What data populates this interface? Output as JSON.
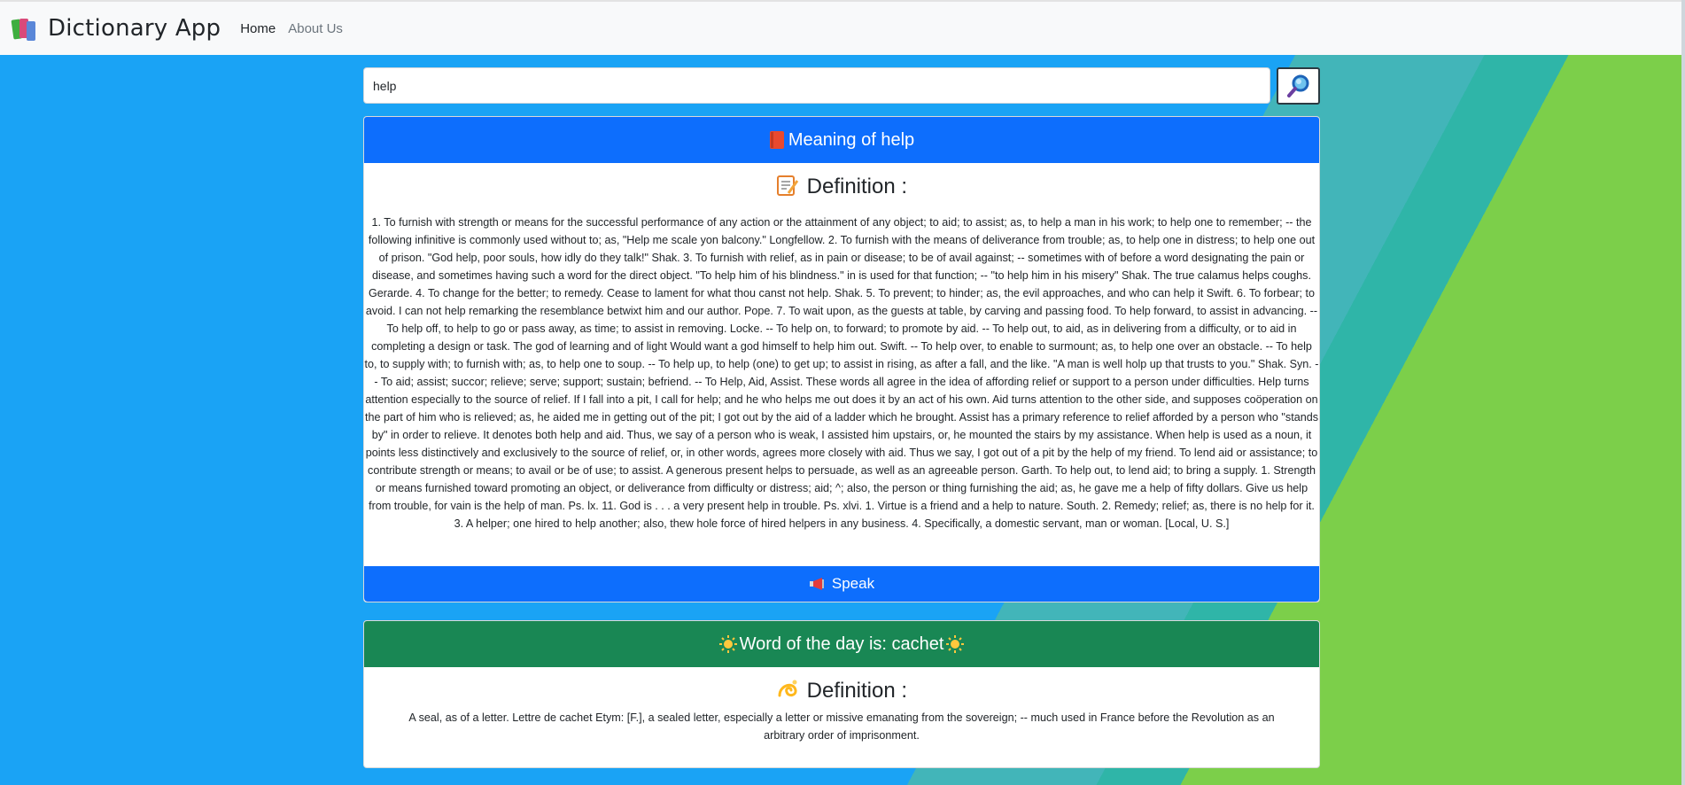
{
  "nav": {
    "brand": "Dictionary App",
    "links": [
      "Home",
      "About Us"
    ]
  },
  "search": {
    "value": "help",
    "button_icon": "magnifier-icon"
  },
  "meaning_card": {
    "header": "Meaning of help",
    "definition_title": "Definition :",
    "definition_text": "1. To furnish with strength or means for the successful performance of any action or the attainment of any object; to aid; to assist; as, to help a man in his work; to help one to remember; -- the following infinitive is commonly used without to; as, \"Help me scale yon balcony.\" Longfellow. 2. To furnish with the means of deliverance from trouble; as, to help one in distress; to help one out of prison. \"God help, poor souls, how idly do they talk!\" Shak. 3. To furnish with relief, as in pain or disease; to be of avail against; -- sometimes with of before a word designating the pain or disease, and sometimes having such a word for the direct object. \"To help him of his blindness.\" in is used for that function; -- \"to help him in his misery\" Shak. The true calamus helps coughs. Gerarde. 4. To change for the better; to remedy. Cease to lament for what thou canst not help. Shak. 5. To prevent; to hinder; as, the evil approaches, and who can help it Swift. 6. To forbear; to avoid. I can not help remarking the resemblance betwixt him and our author. Pope. 7. To wait upon, as the guests at table, by carving and passing food. To help forward, to assist in advancing. -- To help off, to help to go or pass away, as time; to assist in removing. Locke. -- To help on, to forward; to promote by aid. -- To help out, to aid, as in delivering from a difficulty, or to aid in completing a design or task. The god of learning and of light Would want a god himself to help him out. Swift. -- To help over, to enable to surmount; as, to help one over an obstacle. -- To help to, to supply with; to furnish with; as, to help one to soup. -- To help up, to help (one) to get up; to assist in rising, as after a fall, and the like. \"A man is well holp up that trusts to you.\" Shak. Syn. -- To aid; assist; succor; relieve; serve; support; sustain; befriend. -- To Help, Aid, Assist. These words all agree in the idea of affording relief or support to a person under difficulties. Help turns attention especially to the source of relief. If I fall into a pit, I call for help; and he who helps me out does it by an act of his own. Aid turns attention to the other side, and supposes coöperation on the part of him who is relieved; as, he aided me in getting out of the pit; I got out by the aid of a ladder which he brought. Assist has a primary reference to relief afforded by a person who \"stands by\" in order to relieve. It denotes both help and aid. Thus, we say of a person who is weak, I assisted him upstairs, or, he mounted the stairs by my assistance. When help is used as a noun, it points less distinctively and exclusively to the source of relief, or, in other words, agrees more closely with aid. Thus we say, I got out of a pit by the help of my friend. To lend aid or assistance; to contribute strength or means; to avail or be of use; to assist. A generous present helps to persuade, as well as an agreeable person. Garth. To help out, to lend aid; to bring a supply. 1. Strength or means furnished toward promoting an object, or deliverance from difficulty or distress; aid; ^; also, the person or thing furnishing the aid; as, he gave me a help of fifty dollars. Give us help from trouble, for vain is the help of man. Ps. lx. 11. God is . . . a very present help in trouble. Ps. xlvi. 1. Virtue is a friend and a help to nature. South. 2. Remedy; relief; as, there is no help for it. 3. A helper; one hired to help another; also, thew hole force of hired helpers in any business. 4. Specifically, a domestic servant, man or woman. [Local, U. S.]",
    "speak_label": "Speak"
  },
  "wotd_card": {
    "header": "Word of the day is: cachet",
    "definition_title": "Definition :",
    "definition_text": "A seal, as of a letter. Lettre de cachet Etym: [F.], a sealed letter, especially a letter or missive emanating from the sovereign; -- much used in France before the Revolution as an arbitrary order of imprisonment."
  },
  "icons": {
    "brand": "books-icon",
    "meaning": "red-book-icon",
    "memo": "memo-icon",
    "speak": "megaphone-icon",
    "sun": "sun-icon",
    "dizzy": "dizzy-icon"
  },
  "colors": {
    "primary": "#0d6efd",
    "success": "#198754",
    "background": "#1aa3f5",
    "green_stripe": "#7ccf4a"
  }
}
